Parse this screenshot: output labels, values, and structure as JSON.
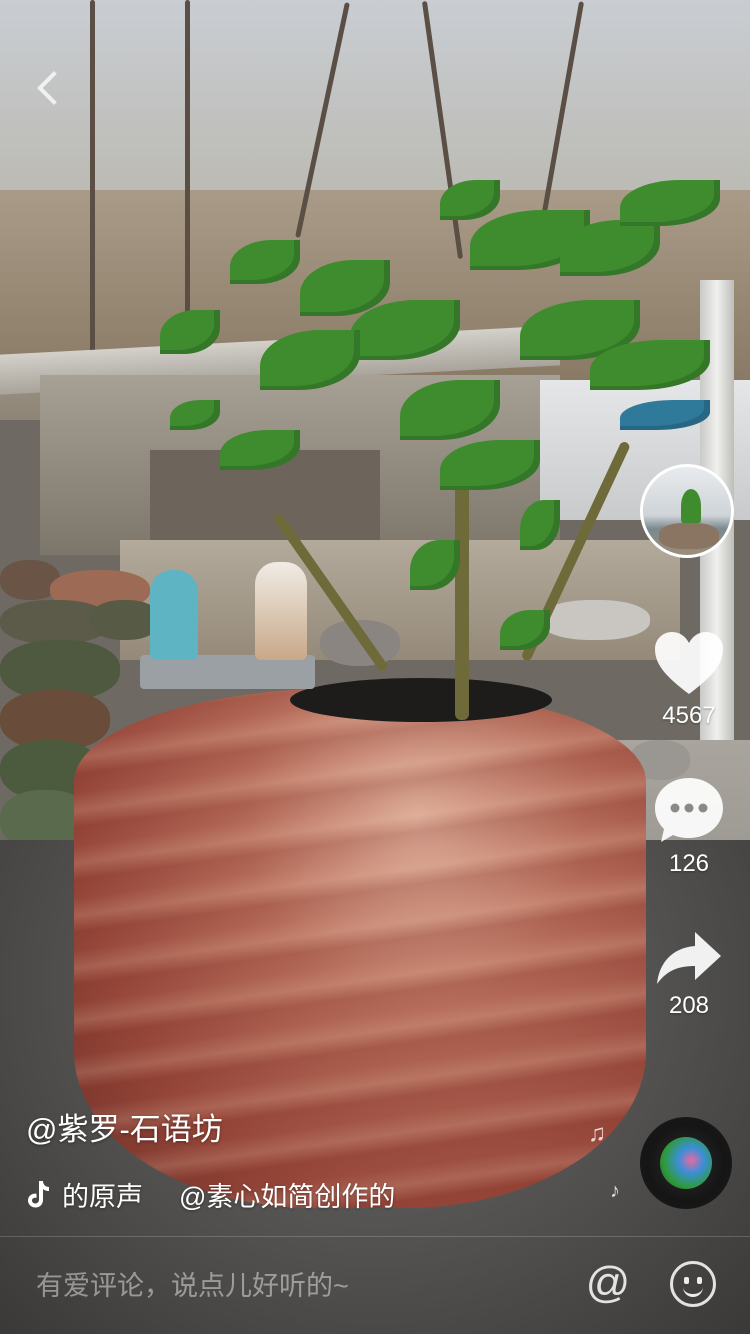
{
  "video": {
    "author": "@紫罗-石语坊",
    "music_original": "的原声",
    "music_credit": "@素心如简创作的"
  },
  "actions": {
    "likes": "4567",
    "comments": "126",
    "shares": "208"
  },
  "comment_bar": {
    "placeholder": "有爱评论，说点儿好听的~",
    "at_symbol": "@"
  },
  "icons": {
    "back": "chevron-left-icon",
    "like": "heart-icon",
    "comment": "comment-bubble-icon",
    "share": "share-arrow-icon",
    "music": "tiktok-note-icon",
    "emoji": "smiley-icon"
  },
  "colors": {
    "overlay_text": "#ffffff",
    "placeholder": "#ffffff73"
  }
}
